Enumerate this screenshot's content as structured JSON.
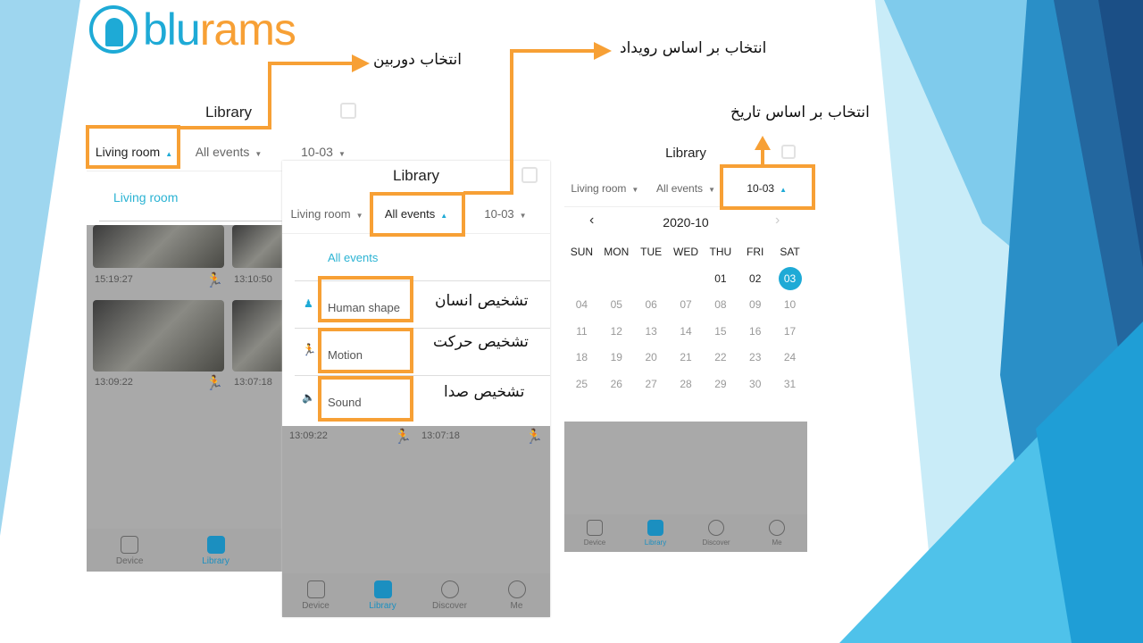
{
  "brand": {
    "logo_text_blue": "blu",
    "logo_text_orange": "rams",
    "blue": "#1eaad6",
    "orange": "#f7a035"
  },
  "annotations": {
    "camera": "انتخاب دوربین",
    "event": "انتخاب بر اساس رویداد",
    "date": "انتخاب بر اساس تاریخ",
    "human": "تشخیص انسان",
    "motion": "تشخیص حرکت",
    "sound": "تشخیص صدا"
  },
  "screen1": {
    "title": "Library",
    "filters": [
      "Living room",
      "All events",
      "10-03"
    ],
    "dropdown_item": "Living room",
    "clips": [
      "15:19:27",
      "13:10:50",
      "13:09:22",
      "13:07:18"
    ]
  },
  "screen2": {
    "title": "Library",
    "filters": [
      "Living room",
      "All events",
      "10-03"
    ],
    "dropdown_header": "All events",
    "events": [
      {
        "label": "Human shape",
        "icon": "human-icon"
      },
      {
        "label": "Motion",
        "icon": "motion-icon"
      },
      {
        "label": "Sound",
        "icon": "speaker-icon"
      }
    ],
    "clips": [
      "13:09:22",
      "13:07:18"
    ]
  },
  "screen3": {
    "title": "Library",
    "filters": [
      "Living room",
      "All events",
      "10-03"
    ],
    "month": "2020-10",
    "weekdays": [
      "SUN",
      "MON",
      "TUE",
      "WED",
      "THU",
      "FRI",
      "SAT"
    ],
    "weeks": [
      [
        "",
        "",
        "",
        "",
        "01",
        "02",
        "03"
      ],
      [
        "04",
        "05",
        "06",
        "07",
        "08",
        "09",
        "10"
      ],
      [
        "11",
        "12",
        "13",
        "14",
        "15",
        "16",
        "17"
      ],
      [
        "18",
        "19",
        "20",
        "21",
        "22",
        "23",
        "24"
      ],
      [
        "25",
        "26",
        "27",
        "28",
        "29",
        "30",
        "31"
      ]
    ],
    "selected": "03"
  },
  "tabs": [
    "Device",
    "Library",
    "Discover",
    "Me"
  ]
}
